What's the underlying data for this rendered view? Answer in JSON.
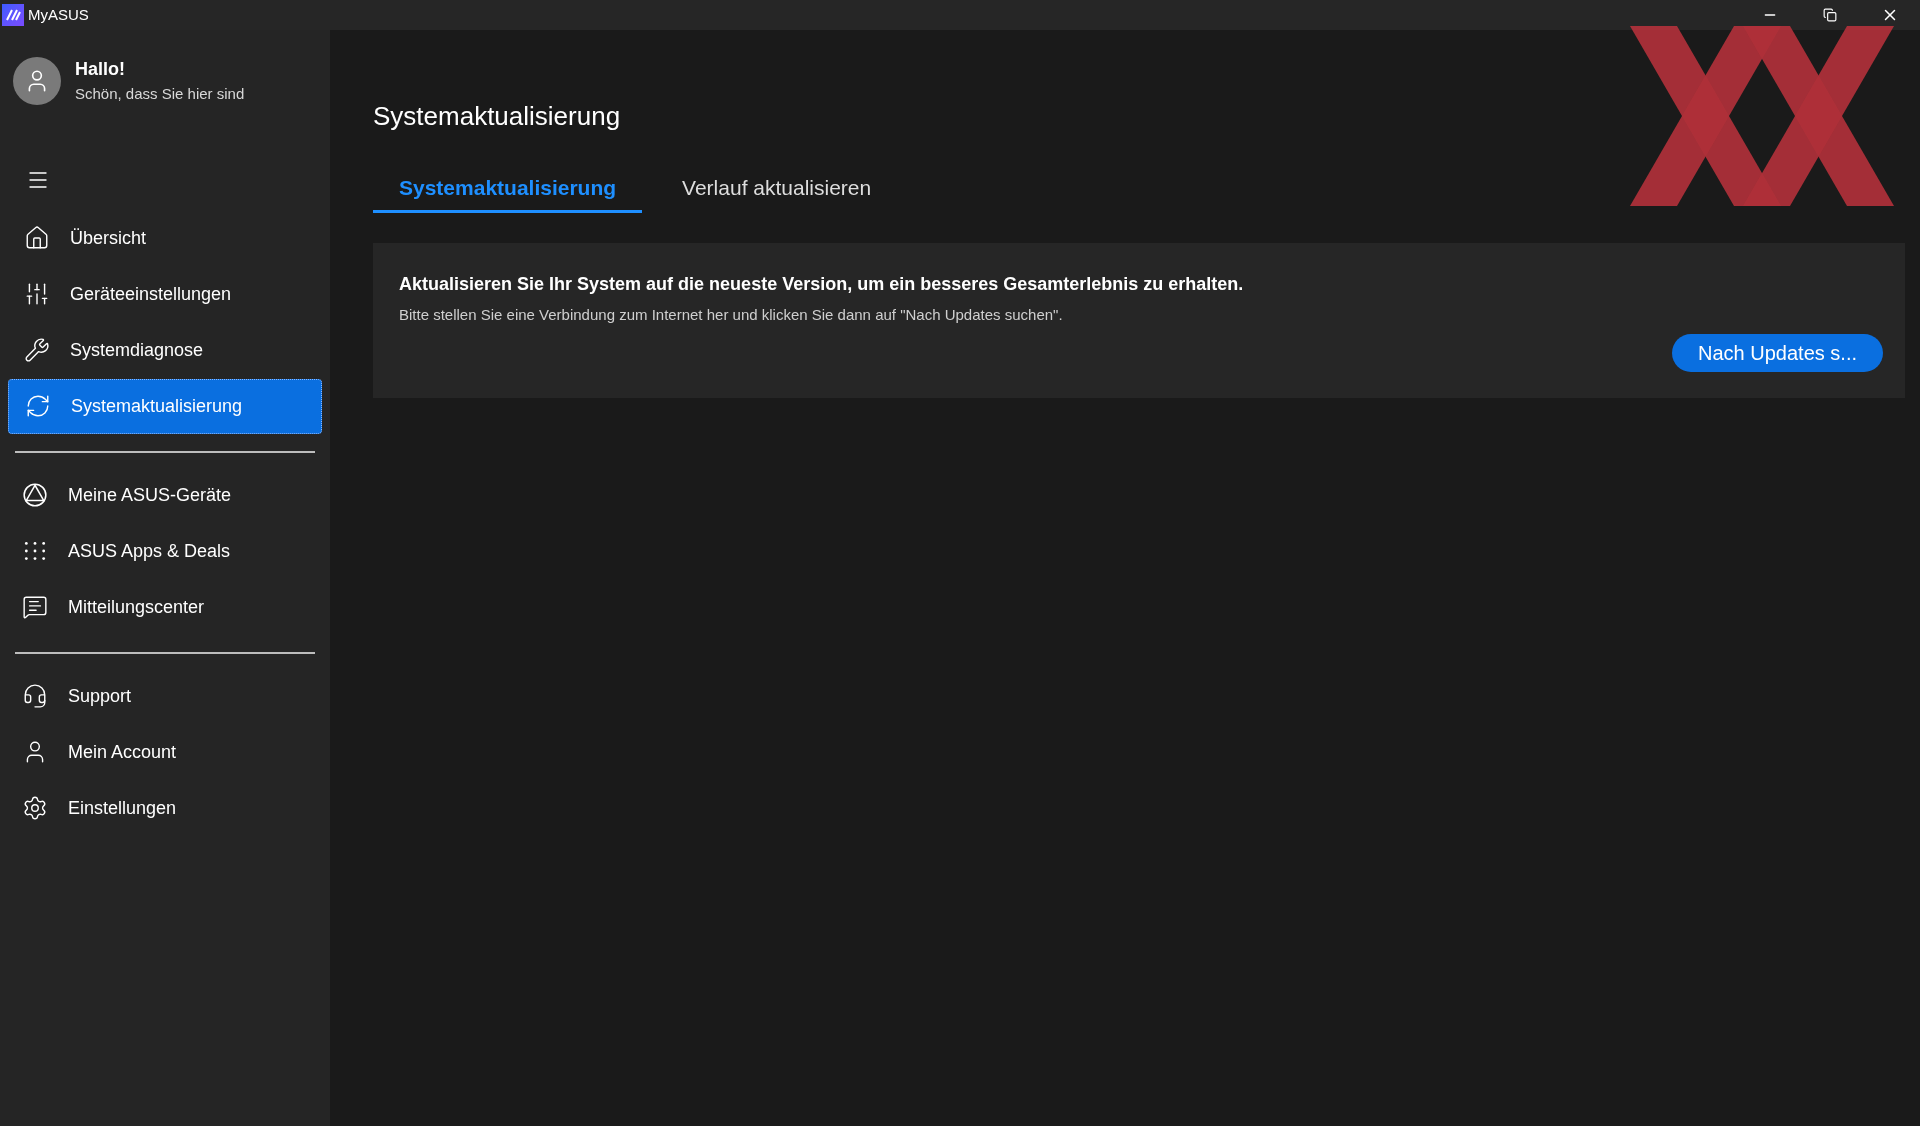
{
  "window": {
    "title": "MyASUS"
  },
  "user": {
    "greeting": "Hallo!",
    "subtitle": "Schön, dass Sie hier sind"
  },
  "sidebar": {
    "groups": [
      [
        {
          "kind": "home",
          "label": "Übersicht",
          "selected": false
        },
        {
          "kind": "sliders",
          "label": "Geräteeinstellungen",
          "selected": false
        },
        {
          "kind": "wrench",
          "label": "Systemdiagnose",
          "selected": false
        },
        {
          "kind": "update",
          "label": "Systemaktualisierung",
          "selected": true
        }
      ],
      [
        {
          "kind": "devices",
          "label": "Meine ASUS-Geräte",
          "selected": false
        },
        {
          "kind": "apps",
          "label": "ASUS Apps & Deals",
          "selected": false
        },
        {
          "kind": "message",
          "label": "Mitteilungscenter",
          "selected": false
        }
      ],
      [
        {
          "kind": "headset",
          "label": "Support",
          "selected": false
        },
        {
          "kind": "user",
          "label": "Mein Account",
          "selected": false
        },
        {
          "kind": "gear",
          "label": "Einstellungen",
          "selected": false
        }
      ]
    ]
  },
  "page": {
    "title": "Systemaktualisierung"
  },
  "tabs": [
    {
      "label": "Systemaktualisierung",
      "selected": true
    },
    {
      "label": "Verlauf aktualisieren",
      "selected": false
    }
  ],
  "card": {
    "heading": "Aktualisieren Sie Ihr System auf die neueste Version, um ein besseres Gesamterlebnis zu erhalten.",
    "text": "Bitte stellen Sie eine Verbindung zum Internet her und klicken Sie dann auf \"Nach Updates suchen\".",
    "button": "Nach Updates s..."
  }
}
